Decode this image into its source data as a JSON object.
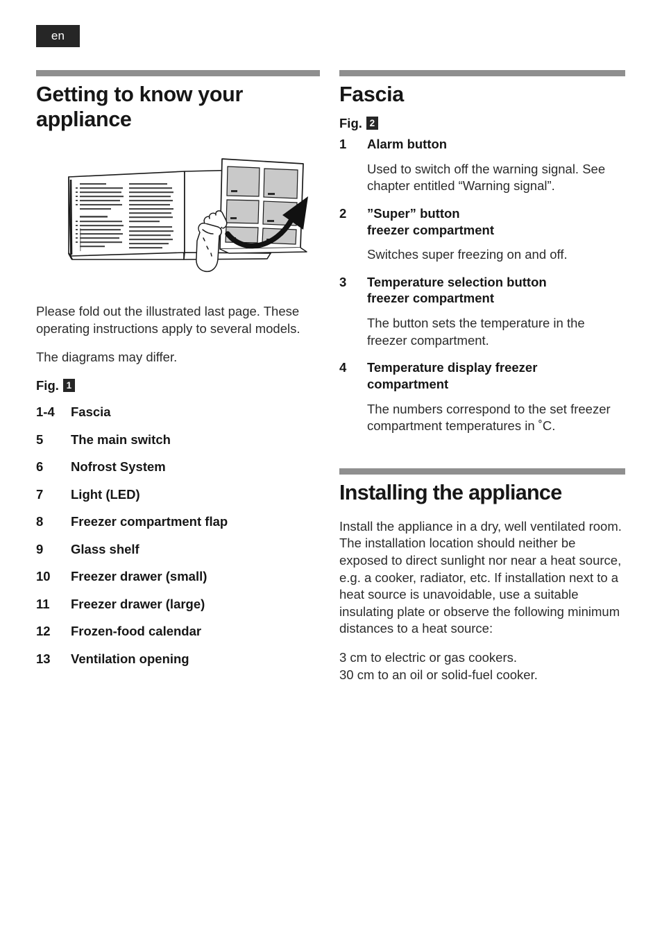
{
  "page": {
    "language_badge": "en"
  },
  "left_column": {
    "title": "Getting to know your appliance",
    "illustration": {
      "name": "fold-out-page-illustration",
      "alt": "Open booklet with illustrated last page being folded out by a hand, arrow pointing right"
    },
    "intro_paragraphs": [
      "Please fold out the illustrated last page. These operating instructions apply to several models.",
      "The diagrams may differ."
    ],
    "fig_label": "Fig.",
    "fig_number": "1",
    "parts": [
      {
        "num": "1-4",
        "label": "Fascia"
      },
      {
        "num": "5",
        "label": "The main switch"
      },
      {
        "num": "6",
        "label": "Nofrost System"
      },
      {
        "num": "7",
        "label": "Light (LED)"
      },
      {
        "num": "8",
        "label": "Freezer compartment flap"
      },
      {
        "num": "9",
        "label": "Glass shelf"
      },
      {
        "num": "10",
        "label": "Freezer drawer (small)"
      },
      {
        "num": "11",
        "label": "Freezer drawer (large)"
      },
      {
        "num": "12",
        "label": "Frozen-food calendar"
      },
      {
        "num": "13",
        "label": "Ventilation opening"
      }
    ]
  },
  "right_column": {
    "fascia_section": {
      "title": "Fascia",
      "fig_label": "Fig.",
      "fig_number": "2",
      "entries": [
        {
          "num": "1",
          "title": "Alarm button",
          "description": "Used to switch off the warning signal. See chapter entitled “Warning signal”."
        },
        {
          "num": "2",
          "title": "”Super” button\nfreezer compartment",
          "description": "Switches  super freezing on and off."
        },
        {
          "num": "3",
          "title": "Temperature selection button\nfreezer compartment",
          "description": "The button sets the temperature in the freezer  compartment."
        },
        {
          "num": "4",
          "title": "Temperature display freezer\ncompartment",
          "description": "The numbers correspond to the set freezer  compartment  temperatures in ˚C."
        }
      ]
    },
    "installing_section": {
      "title": "Installing the appliance",
      "paragraphs": [
        "Install the appliance in a dry, well ventilated room. The installation location should neither be exposed to direct sunlight nor near a heat source, e.g. a cooker, radiator, etc. If installation next to a heat source is unavoidable, use a suitable insulating plate or observe the following minimum distances to a heat source:",
        "3 cm to electric or gas cookers.\n30 cm to an oil or solid-fuel cooker."
      ]
    }
  },
  "colors": {
    "rule": "#8f8f8f",
    "badge": "#262626",
    "text": "#1a1a1a",
    "panel_fill": "#c9c9c9"
  }
}
